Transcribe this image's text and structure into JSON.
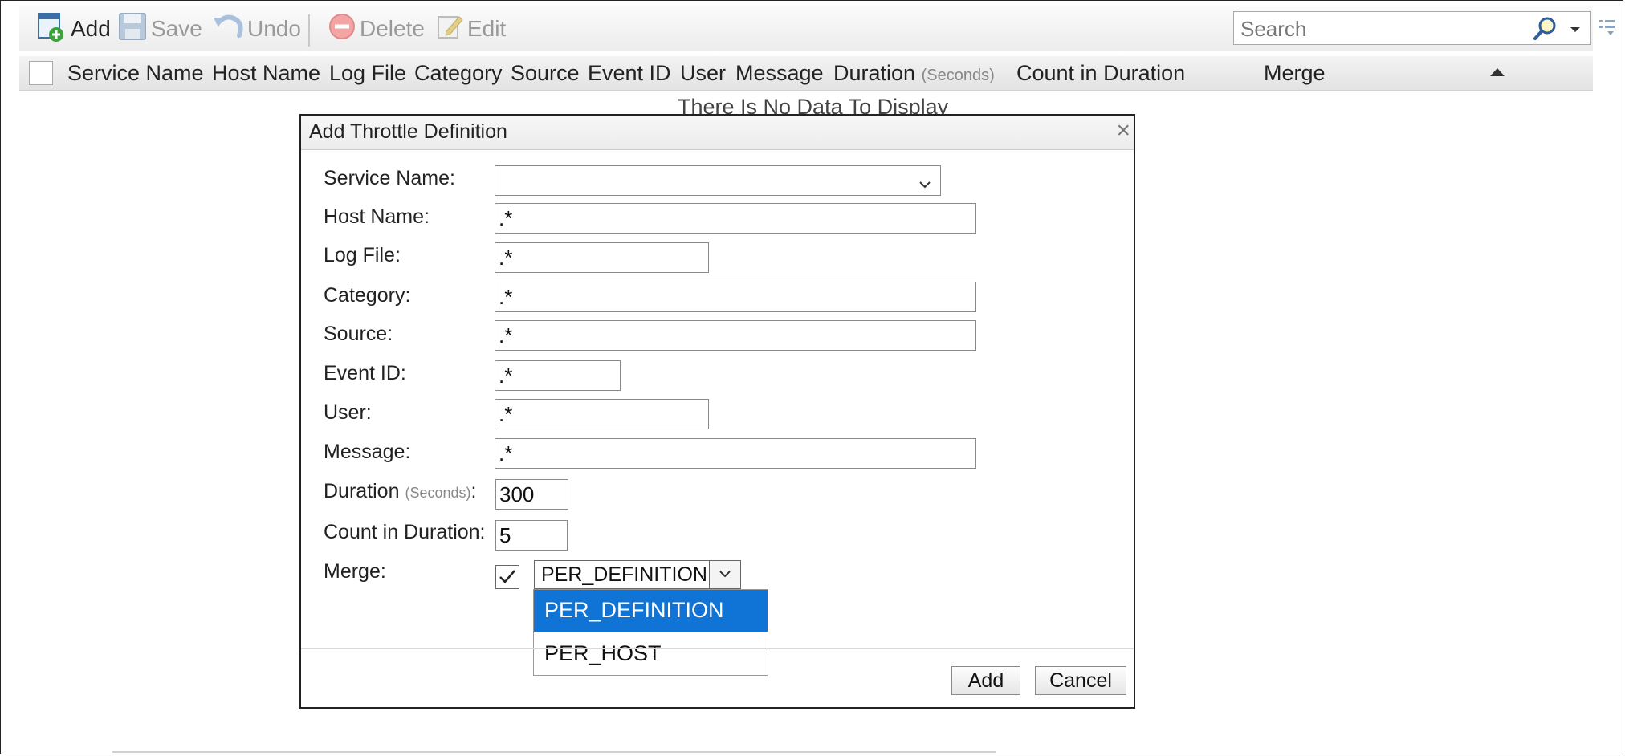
{
  "toolbar": {
    "add_label": "Add",
    "save_label": "Save",
    "undo_label": "Undo",
    "delete_label": "Delete",
    "edit_label": "Edit",
    "search_placeholder": "Search"
  },
  "grid": {
    "columns": {
      "service_name": "Service Name",
      "host_name": "Host Name",
      "log_file": "Log File",
      "category": "Category",
      "source": "Source",
      "event_id": "Event ID",
      "user": "User",
      "message": "Message",
      "duration": "Duration",
      "duration_unit": "(Seconds)",
      "count_in_duration": "Count in Duration",
      "merge": "Merge"
    },
    "empty_message": "There Is No Data To Display"
  },
  "dialog": {
    "title": "Add Throttle Definition",
    "close_glyph": "×",
    "fields": {
      "service_name": {
        "label": "Service Name:",
        "value": ""
      },
      "host_name": {
        "label": "Host Name:",
        "value": ".*"
      },
      "log_file": {
        "label": "Log File:",
        "value": ".*"
      },
      "category": {
        "label": "Category:",
        "value": ".*"
      },
      "source": {
        "label": "Source:",
        "value": ".*"
      },
      "event_id": {
        "label": "Event ID:",
        "value": ".*"
      },
      "user": {
        "label": "User:",
        "value": ".*"
      },
      "message": {
        "label": "Message:",
        "value": ".*"
      },
      "duration": {
        "label": "Duration",
        "unit": "(Seconds)",
        "colon": ":",
        "value": "300"
      },
      "count_in_duration": {
        "label": "Count in Duration:",
        "value": "5"
      },
      "merge": {
        "label": "Merge:",
        "checked": true,
        "selected": "PER_DEFINITION",
        "options": [
          "PER_DEFINITION",
          "PER_HOST"
        ]
      }
    },
    "add_button": "Add",
    "cancel_button": "Cancel"
  },
  "colors": {
    "selected_option": "#0f74d6",
    "add_icon_green": "#3aa43a",
    "toolbar_disabled": "#999999"
  }
}
